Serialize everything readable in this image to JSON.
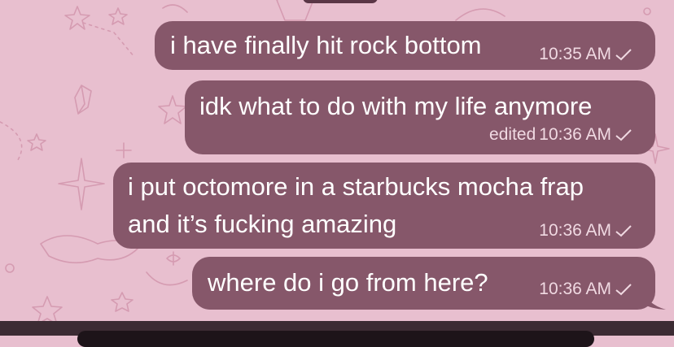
{
  "messages": [
    {
      "text": [
        "i have finally hit rock bottom"
      ],
      "time": "10:35 AM",
      "edited": ""
    },
    {
      "text": [
        "idk what to do with my life anymore"
      ],
      "time": "10:36 AM",
      "edited": "edited"
    },
    {
      "text": [
        "i put octomore in a starbucks mocha frap",
        "and it’s fucking amazing"
      ],
      "time": "10:36 AM",
      "edited": ""
    },
    {
      "text": [
        "where do i go from here?"
      ],
      "time": "10:36 AM",
      "edited": ""
    }
  ],
  "icons": {
    "read_status": "single-check-icon",
    "wallpaper": "celestial-doodle-pattern"
  },
  "colors": {
    "background": "#e8bfcf",
    "bubble": "#86576a",
    "text": "#ffffff",
    "meta": "#f0d9e2"
  }
}
